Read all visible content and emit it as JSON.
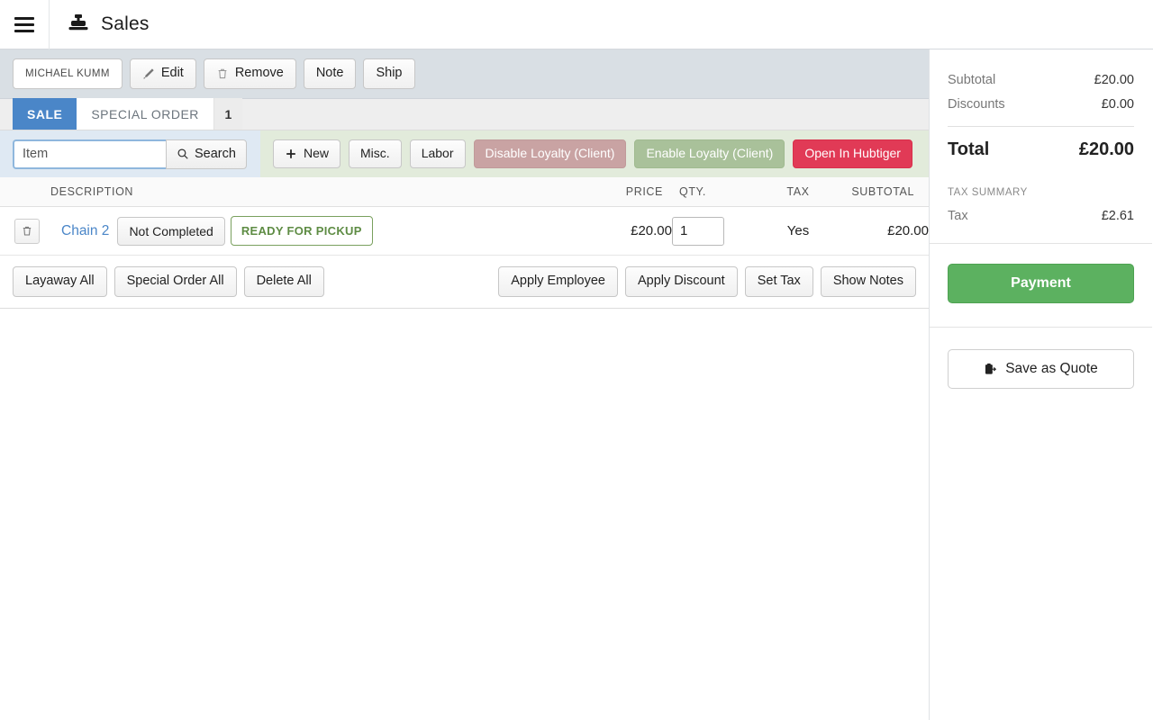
{
  "header": {
    "title": "Sales",
    "menu_icon": "hamburger-menu-icon",
    "app_icon": "cash-register-icon"
  },
  "customer_toolbar": {
    "customer_name": "MICHAEL KUMM",
    "edit_label": "Edit",
    "remove_label": "Remove",
    "note_label": "Note",
    "ship_label": "Ship"
  },
  "tabs": [
    {
      "label": "SALE",
      "active": true
    },
    {
      "label": "SPECIAL ORDER",
      "active": false,
      "badge": "1"
    }
  ],
  "search": {
    "placeholder": "Item",
    "value": "",
    "button_label": "Search",
    "icon": "magnifier-icon"
  },
  "operations": {
    "new_label": "New",
    "misc_label": "Misc.",
    "labor_label": "Labor",
    "disable_loyalty_label": "Disable Loyalty (Client)",
    "enable_loyalty_label": "Enable Loyalty (Client)",
    "open_hubtiger_label": "Open In Hubtiger"
  },
  "items_table": {
    "columns": [
      "",
      "DESCRIPTION",
      "PRICE",
      "QTY.",
      "TAX",
      "SUBTOTAL"
    ],
    "rows": [
      {
        "name": "Chain 2",
        "status_label": "Not Completed",
        "pickup_label": "READY FOR PICKUP",
        "price": "£20.00",
        "qty": "1",
        "tax": "Yes",
        "subtotal": "£20.00",
        "delete_icon": "trash-icon"
      }
    ]
  },
  "bottom_actions": {
    "layaway_all": "Layaway All",
    "special_order_all": "Special Order All",
    "delete_all": "Delete All",
    "apply_employee": "Apply Employee",
    "apply_discount": "Apply Discount",
    "set_tax": "Set Tax",
    "show_notes": "Show Notes"
  },
  "summary": {
    "subtotal_label": "Subtotal",
    "subtotal_value": "£20.00",
    "discounts_label": "Discounts",
    "discounts_value": "£0.00",
    "total_label": "Total",
    "total_value": "£20.00",
    "tax_summary_label": "TAX SUMMARY",
    "tax_label": "Tax",
    "tax_value": "£2.61",
    "payment_label": "Payment",
    "quote_label": "Save as Quote",
    "quote_icon": "clipboard-quote-icon"
  },
  "colors": {
    "accent_blue": "#4a86c8",
    "payment_green": "#5cb160",
    "hubtiger_red": "#e13a56",
    "loyalty_off": "#c9a3a3",
    "loyalty_on": "#a9c19a",
    "pickup_green": "#5e8c44",
    "toolbar_bg": "#d9dfe4",
    "search_bg": "#dfe9f3",
    "ops_bg": "#e2ebdb"
  }
}
